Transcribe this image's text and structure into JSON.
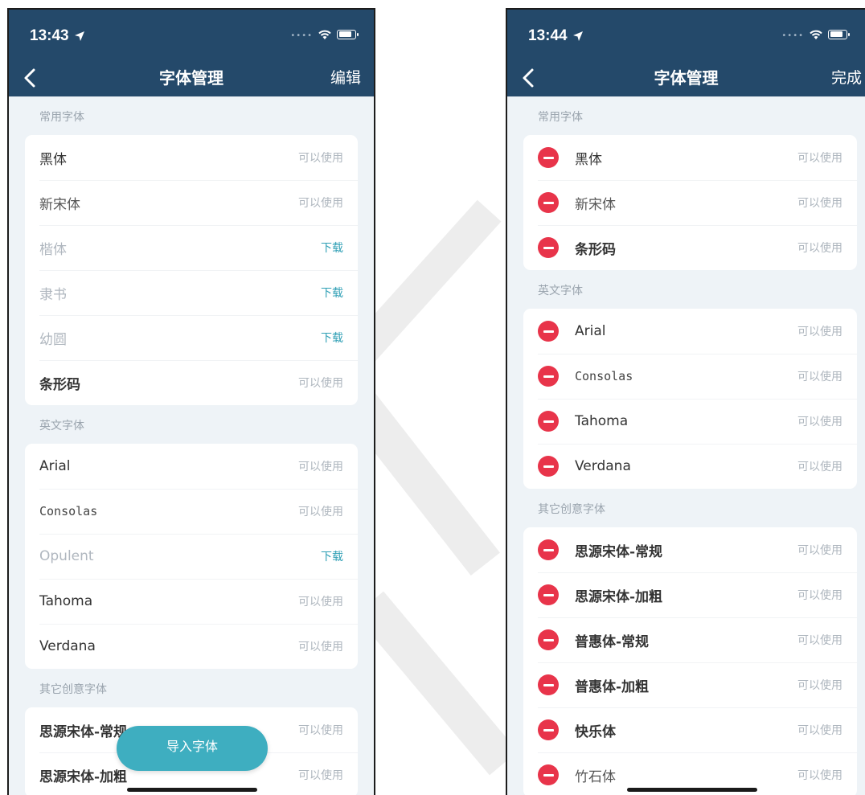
{
  "left_screen": {
    "status_time": "13:43",
    "title": "字体管理",
    "action": "编辑",
    "sections": [
      {
        "header": "常用字体",
        "items": [
          {
            "name": "黑体",
            "status": "可以使用"
          },
          {
            "name": "新宋体",
            "status": "可以使用"
          },
          {
            "name": "楷体",
            "status": "下载"
          },
          {
            "name": "隶书",
            "status": "下载"
          },
          {
            "name": "幼圆",
            "status": "下载"
          },
          {
            "name": "条形码",
            "status": "可以使用"
          }
        ]
      },
      {
        "header": "英文字体",
        "items": [
          {
            "name": "Arial",
            "status": "可以使用"
          },
          {
            "name": "Consolas",
            "status": "可以使用"
          },
          {
            "name": "Opulent",
            "status": "下载"
          },
          {
            "name": "Tahoma",
            "status": "可以使用"
          },
          {
            "name": "Verdana",
            "status": "可以使用"
          }
        ]
      },
      {
        "header": "其它创意字体",
        "items": [
          {
            "name": "思源宋体-常规",
            "status": "可以使用"
          },
          {
            "name": "思源宋体-加粗",
            "status": "可以使用"
          }
        ]
      }
    ],
    "import_button": "导入字体"
  },
  "right_screen": {
    "status_time": "13:44",
    "title": "字体管理",
    "action": "完成",
    "sections": [
      {
        "header": "常用字体",
        "items": [
          {
            "name": "黑体",
            "status": "可以使用"
          },
          {
            "name": "新宋体",
            "status": "可以使用"
          },
          {
            "name": "条形码",
            "status": "可以使用"
          }
        ]
      },
      {
        "header": "英文字体",
        "items": [
          {
            "name": "Arial",
            "status": "可以使用"
          },
          {
            "name": "Consolas",
            "status": "可以使用"
          },
          {
            "name": "Tahoma",
            "status": "可以使用"
          },
          {
            "name": "Verdana",
            "status": "可以使用"
          }
        ]
      },
      {
        "header": "其它创意字体",
        "items": [
          {
            "name": "思源宋体-常规",
            "status": "可以使用"
          },
          {
            "name": "思源宋体-加粗",
            "status": "可以使用"
          },
          {
            "name": "普惠体-常规",
            "status": "可以使用"
          },
          {
            "name": "普惠体-加粗",
            "status": "可以使用"
          },
          {
            "name": "快乐体",
            "status": "可以使用"
          },
          {
            "name": "竹石体",
            "status": "可以使用"
          }
        ]
      }
    ]
  },
  "icons": {
    "back": "chevron-left-icon",
    "location": "location-arrow-icon",
    "wifi": "wifi-icon",
    "battery": "battery-icon",
    "delete": "minus-circle-icon"
  },
  "colors": {
    "nav_bar": "#24496a",
    "download_text": "#2f9fb5",
    "delete_red": "#e8344a",
    "import_button": "#3eaec0",
    "background": "#eef3f7"
  }
}
